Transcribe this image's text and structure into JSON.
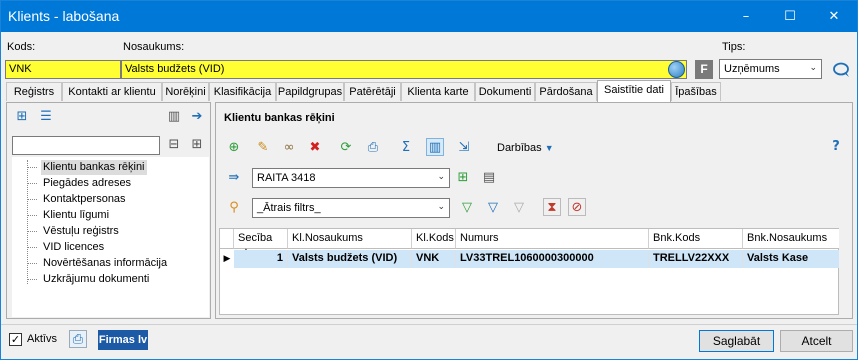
{
  "window": {
    "title": "Klients - labošana",
    "minimize": "–",
    "maximize": "☐",
    "close": "✕"
  },
  "header": {
    "kods_label": "Kods:",
    "kods_value": "VNK",
    "nosaukums_label": "Nosaukums:",
    "nosaukums_value": "Valsts budžets (VID)",
    "f_badge": "F",
    "tips_label": "Tips:",
    "tips_value": "Uzņēmums"
  },
  "tabs": [
    "Reģistrs",
    "Kontakti ar klientu",
    "Norēķini",
    "Klasifikācija",
    "Papildgrupas",
    "Patērētāji",
    "Klienta karte",
    "Dokumenti",
    "Pārdošana",
    "Saistītie dati",
    "Īpašības"
  ],
  "tree": {
    "items": [
      "Klientu bankas rēķini",
      "Piegādes adreses",
      "Kontaktpersonas",
      "Klientu līgumi",
      "Vēstuļu reģistrs",
      "VID licences",
      "Novērtēšanas informācija",
      "Uzkrājumu dokumenti"
    ]
  },
  "right": {
    "title": "Klientu bankas rēķini",
    "actions_label": "Darbības",
    "layout_combo": "RAITA 3418",
    "filter_combo": "_Ātrais filtrs_",
    "help": "?"
  },
  "grid": {
    "columns": [
      "Secība",
      "Kl.Nosaukums",
      "Kl.Kods",
      "Numurs",
      "Bnk.Kods",
      "Bnk.Nosaukums"
    ],
    "sort_indicator": "▲",
    "rows": [
      {
        "seciba": "1",
        "kl_nosaukums": "Valsts budžets (VID)",
        "kl_kods": "VNK",
        "numurs": "LV33TREL1060000300000",
        "bnk_kods": "TRELLV22XXX",
        "bnk_nosaukums": "Valsts Kase"
      }
    ]
  },
  "footer": {
    "aktivs_label": "Aktīvs",
    "firmas_label": "Firmas lv",
    "save_label": "Saglabāt",
    "cancel_label": "Atcelt"
  },
  "colors": {
    "titlebar": "#0078d7",
    "required_field": "#ffff33",
    "selected_row": "#cfe6f8"
  }
}
